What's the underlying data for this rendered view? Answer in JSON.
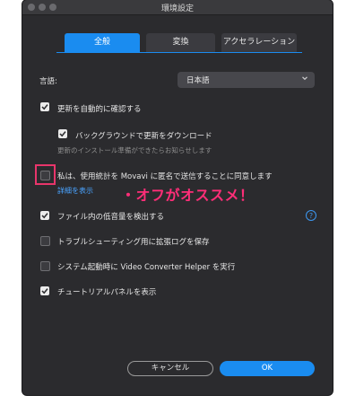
{
  "window": {
    "title": "環境設定"
  },
  "tabs": [
    {
      "label": "全般",
      "active": true
    },
    {
      "label": "変換",
      "active": false
    },
    {
      "label": "アクセラレーション",
      "active": false
    }
  ],
  "language": {
    "label": "言語:",
    "value": "日本語"
  },
  "options": {
    "auto_update": {
      "label": "更新を自動的に確認する",
      "checked": true
    },
    "background_download": {
      "label": "バックグラウンドで更新をダウンロード",
      "checked": true,
      "hint": "更新のインストール準備ができたらお知らせします"
    },
    "send_stats": {
      "label": "私は、使用統計を Movavi に匿名で送信することに同意します",
      "checked": false,
      "link": "詳細を表示"
    },
    "detect_low_volume": {
      "label": "ファイル内の低音量を検出する",
      "checked": true
    },
    "extended_log": {
      "label": "トラブルシューティング用に拡張ログを保存",
      "checked": false
    },
    "run_helper": {
      "label": "システム起動時に Video Converter Helper を実行",
      "checked": false
    },
    "show_tutorial": {
      "label": "チュートリアルパネルを表示",
      "checked": true
    }
  },
  "annotation": {
    "text": "・オフがオススメ！",
    "color": "#ff2e78"
  },
  "buttons": {
    "cancel": "キャンセル",
    "ok": "OK"
  },
  "colors": {
    "accent": "#1a8cf0",
    "highlight": "#e8356b"
  }
}
